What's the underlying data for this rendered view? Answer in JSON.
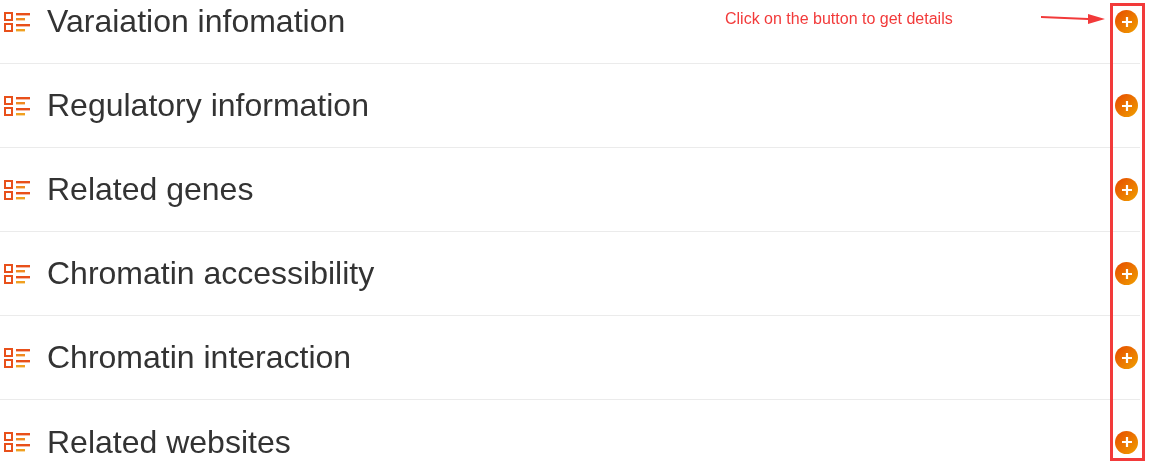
{
  "sections": [
    {
      "title": "Varaiation infomation"
    },
    {
      "title": "Regulatory information"
    },
    {
      "title": "Related genes"
    },
    {
      "title": "Chromatin accessibility"
    },
    {
      "title": "Chromatin interaction"
    },
    {
      "title": "Related websites"
    }
  ],
  "annotation": {
    "text": "Click on the button to get details"
  }
}
